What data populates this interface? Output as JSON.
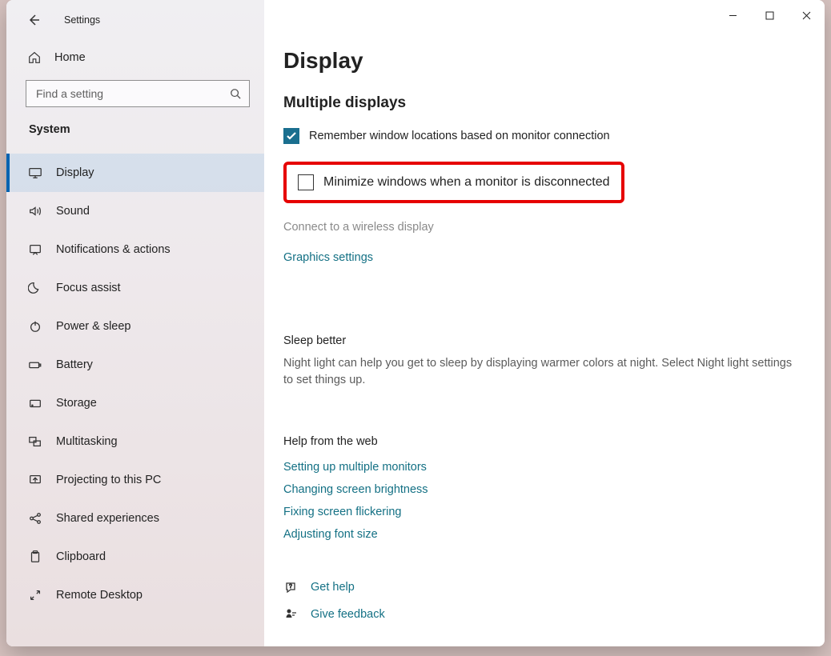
{
  "window": {
    "title": "Settings",
    "home_label": "Home",
    "search_placeholder": "Find a setting",
    "category": "System"
  },
  "nav": {
    "items": [
      {
        "id": "display",
        "label": "Display",
        "active": true
      },
      {
        "id": "sound",
        "label": "Sound"
      },
      {
        "id": "notifications",
        "label": "Notifications & actions"
      },
      {
        "id": "focus-assist",
        "label": "Focus assist"
      },
      {
        "id": "power-sleep",
        "label": "Power & sleep"
      },
      {
        "id": "battery",
        "label": "Battery"
      },
      {
        "id": "storage",
        "label": "Storage"
      },
      {
        "id": "multitasking",
        "label": "Multitasking"
      },
      {
        "id": "projecting",
        "label": "Projecting to this PC"
      },
      {
        "id": "shared-exp",
        "label": "Shared experiences"
      },
      {
        "id": "clipboard",
        "label": "Clipboard"
      },
      {
        "id": "remote-desktop",
        "label": "Remote Desktop"
      }
    ]
  },
  "page": {
    "title": "Display",
    "section_multi": "Multiple displays",
    "cb_remember": "Remember window locations based on monitor connection",
    "cb_minimize": "Minimize windows when a monitor is disconnected",
    "connect_wireless": "Connect to a wireless display",
    "graphics_settings": "Graphics settings",
    "sleep": {
      "title": "Sleep better",
      "body": "Night light can help you get to sleep by displaying warmer colors at night. Select Night light settings to set things up."
    },
    "help": {
      "title": "Help from the web",
      "links": [
        "Setting up multiple monitors",
        "Changing screen brightness",
        "Fixing screen flickering",
        "Adjusting font size"
      ]
    },
    "footer": {
      "get_help": "Get help",
      "give_feedback": "Give feedback"
    }
  }
}
